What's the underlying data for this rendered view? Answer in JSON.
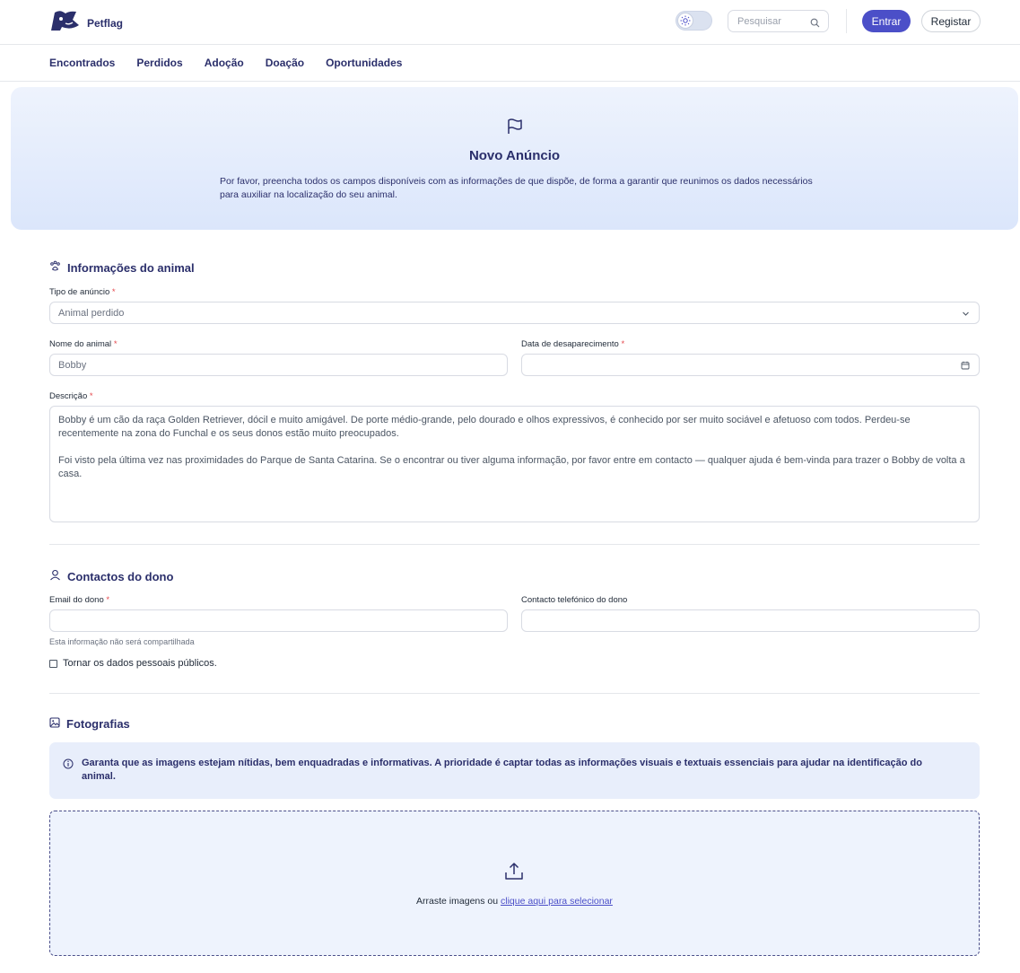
{
  "header": {
    "brand_name": "Petflag",
    "search_placeholder": "Pesquisar",
    "login_label": "Entrar",
    "register_label": "Registar"
  },
  "nav": {
    "items": [
      "Encontrados",
      "Perdidos",
      "Adoção",
      "Doação",
      "Oportunidades"
    ]
  },
  "hero": {
    "title": "Novo Anúncio",
    "description": "Por favor, preencha todos os campos disponíveis com as informações de que dispõe, de forma a garantir que reunimos os dados necessários para auxiliar na localização do seu animal."
  },
  "animal_section": {
    "title": "Informações do animal",
    "ad_type_label": "Tipo de anúncio",
    "ad_type_value": "Animal perdido",
    "name_label": "Nome do animal",
    "name_value": "Bobby",
    "date_label": "Data de desaparecimento",
    "date_value": "",
    "description_label": "Descrição",
    "description_p1": "Bobby é um cão da raça Golden Retriever, dócil e muito amigável. De porte médio-grande, pelo dourado e olhos expressivos, é conhecido por ser muito sociável e afetuoso com todos. Perdeu-se recentemente na zona do Funchal e os seus donos estão muito preocupados.",
    "description_p2": "Foi visto pela última vez nas proximidades do Parque de Santa Catarina. Se o encontrar ou tiver alguma informação, por favor entre em contacto — qualquer ajuda é bem-vinda para trazer o Bobby de volta a casa."
  },
  "owner_section": {
    "title": "Contactos do dono",
    "email_label": "Email do dono",
    "email_value": "",
    "phone_label": "Contacto telefónico do dono",
    "phone_value": "",
    "privacy_hint": "Esta informação não será compartilhada",
    "public_checkbox_label": "Tornar os dados pessoais públicos.",
    "public_checked": false
  },
  "photos_section": {
    "title": "Fotografias",
    "info_text": "Garanta que as imagens estejam nítidas, bem enquadradas e informativas. A prioridade é captar todas as informações visuais e textuais essenciais para ajudar na identificação do animal.",
    "drop_text": "Arraste imagens ou",
    "drop_link": "clique aqui para selecionar"
  },
  "required_marker": "*",
  "colors": {
    "brand": "#2b2f6b",
    "accent": "#4b4fc8",
    "required": "#e5484d",
    "hero_bg": "#dbe6fb"
  },
  "icons": {
    "theme": "sun-icon",
    "search": "search-icon",
    "hero": "flag-icon",
    "animal": "paw-icon",
    "owner": "user-icon",
    "photos": "image-icon",
    "info": "info-icon",
    "upload": "upload-icon",
    "calendar": "calendar-icon",
    "select": "chevron-down-icon"
  }
}
